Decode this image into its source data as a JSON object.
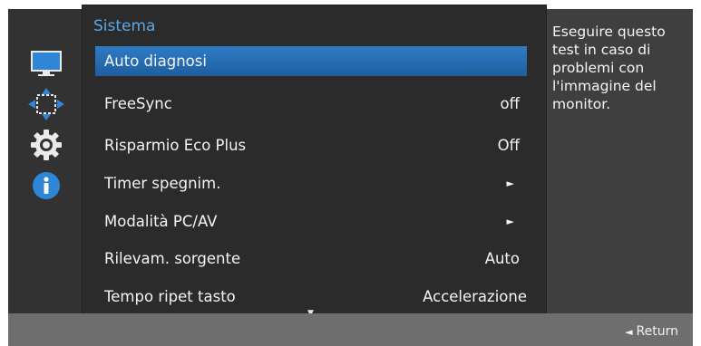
{
  "menu": {
    "title": "Sistema",
    "items": [
      {
        "label": "Auto diagnosi",
        "value": ""
      },
      {
        "label": "FreeSync",
        "value": "off"
      },
      {
        "label": "Risparmio Eco Plus",
        "value": "Off"
      },
      {
        "label": "Timer spegnim.",
        "value": "►"
      },
      {
        "label": "Modalità PC/AV",
        "value": "►"
      },
      {
        "label": "Rilevam. sorgente",
        "value": "Auto"
      },
      {
        "label": "Tempo ripet tasto",
        "value": "Accelerazione"
      }
    ],
    "selected_index": 0,
    "scroll_indicator": "▼"
  },
  "description": "Eseguire questo test in caso di problemi con l'immagine del monitor.",
  "footer": {
    "return_label": "Return",
    "return_arrow": "◄"
  },
  "sidebar_icons": [
    "monitor-icon",
    "move-arrows-icon",
    "settings-gear-icon",
    "info-icon"
  ],
  "colors": {
    "accent": "#5aa8e6",
    "selected": "#2f7bc5",
    "panel": "#3f3f3f",
    "footer": "#6e6e6e"
  }
}
